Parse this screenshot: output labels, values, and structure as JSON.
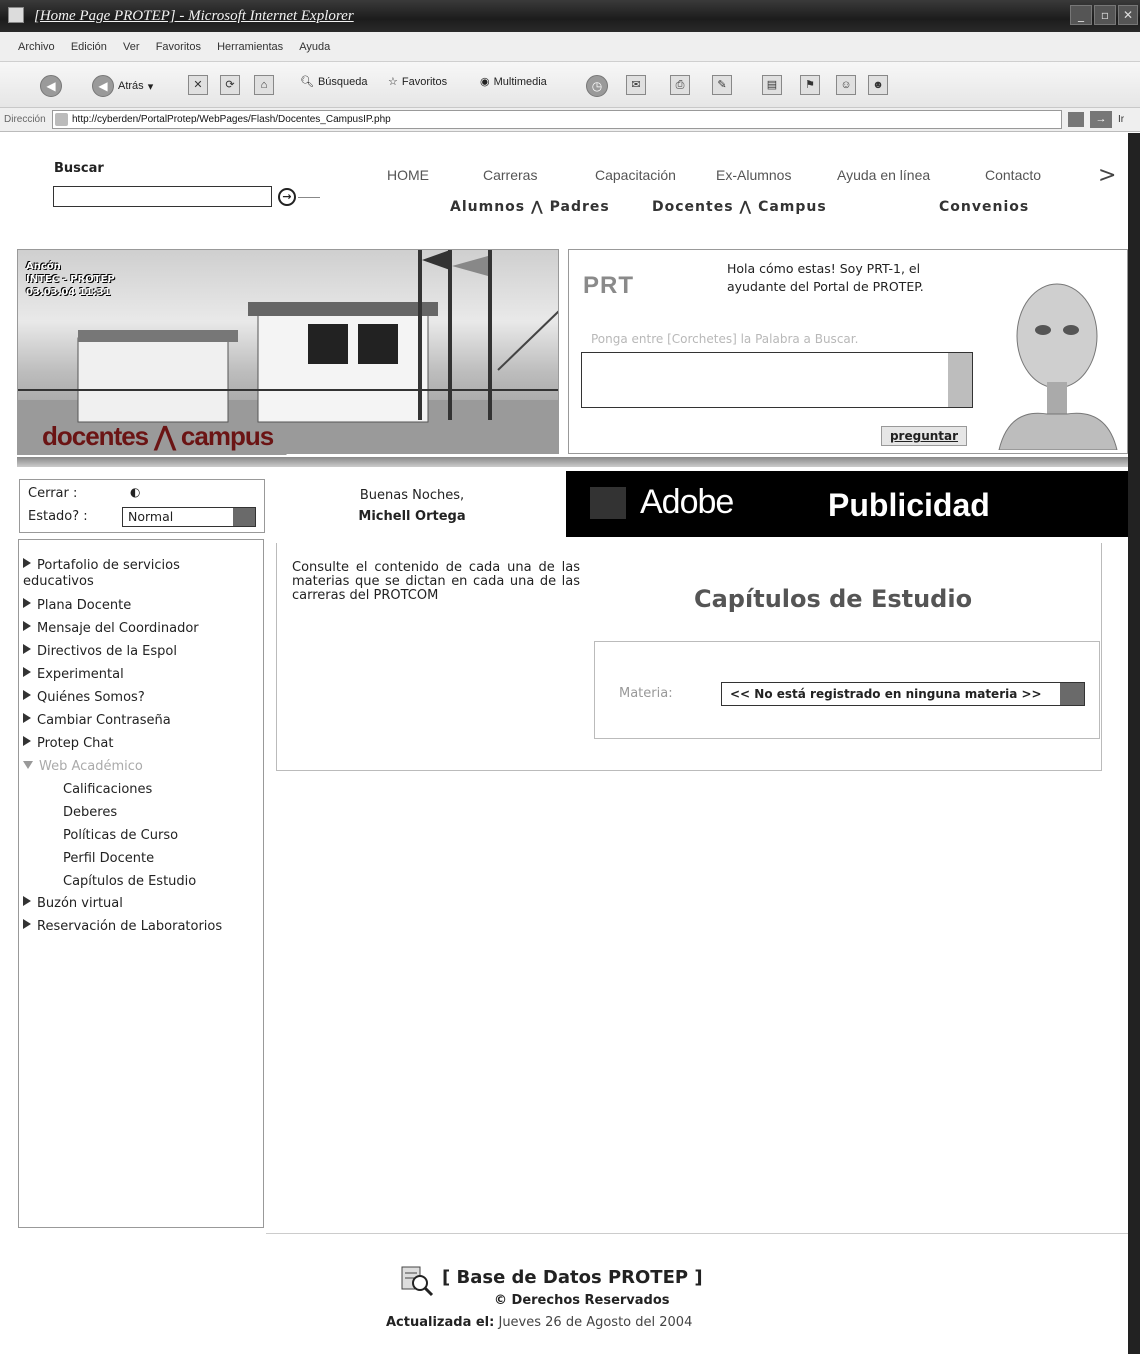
{
  "window": {
    "title": "[Home Page PROTEP] - Microsoft Internet Explorer"
  },
  "menu": [
    "Archivo",
    "Edición",
    "Ver",
    "Favoritos",
    "Herramientas",
    "Ayuda"
  ],
  "toolbar": {
    "back": "Atrás",
    "search": "Búsqueda",
    "favorites": "Favoritos",
    "multimedia": "Multimedia"
  },
  "address": {
    "label": "Dirección",
    "url": "http://cyberden/PortalProtep/WebPages/Flash/Docentes_CampusIP.php",
    "go": "Ir"
  },
  "search": {
    "label": "Buscar",
    "value": ""
  },
  "topnav": [
    "HOME",
    "Carreras",
    "Capacitación",
    "Ex-Alumnos",
    "Ayuda en línea",
    "Contacto"
  ],
  "subnav": {
    "alumnos_padres": "Alumnos ⋀ Padres",
    "docentes_campus": "Docentes ⋀ Campus",
    "convenios": "Convenios"
  },
  "banner": {
    "caption": "Ancón\nINTEC - PROTEP\n03.03.04 11:31",
    "logo": "docentes ⋀ campus"
  },
  "assistant": {
    "logo": "PRT",
    "greeting": "Hola cómo estas! Soy PRT-1, el ayudante del Portal de PROTEP.",
    "hint": "Ponga entre [Corchetes] la Palabra a Buscar.",
    "ask_label": "preguntar"
  },
  "status": {
    "close_label": "Cerrar  :",
    "state_label": "Estado? :",
    "state_value": "Normal"
  },
  "greeting": {
    "line": "Buenas Noches,",
    "name": "Michell Ortega"
  },
  "ad": {
    "brand": "Adobe",
    "label": "Publicidad"
  },
  "sidebar": {
    "items": [
      "Portafolio de servicios educativos",
      "Plana Docente",
      "Mensaje del Coordinador",
      "Directivos de la Espol",
      "Experimental",
      "Quiénes Somos?",
      "Cambiar Contraseña",
      "Protep Chat",
      "Web Académico"
    ],
    "subitems": [
      "Calificaciones",
      "Deberes",
      "Políticas de Curso",
      "Perfil Docente",
      "Capítulos de Estudio"
    ],
    "items_after": [
      "Buzón virtual",
      "Reservación de Laboratorios"
    ]
  },
  "main": {
    "intro": "Consulte el contenido de cada una de las materias que se dictan en cada una de las carreras del PROTCOM",
    "title": "Capítulos de Estudio",
    "materia_label": "Materia:",
    "materia_value": "<< No está registrado en ninguna materia >>"
  },
  "footer": {
    "title": "[ Base de Datos PROTEP ]",
    "rights": "© Derechos Reservados",
    "updated_label": "Actualizada el:",
    "updated_value": "Jueves 26 de Agosto del 2004"
  }
}
